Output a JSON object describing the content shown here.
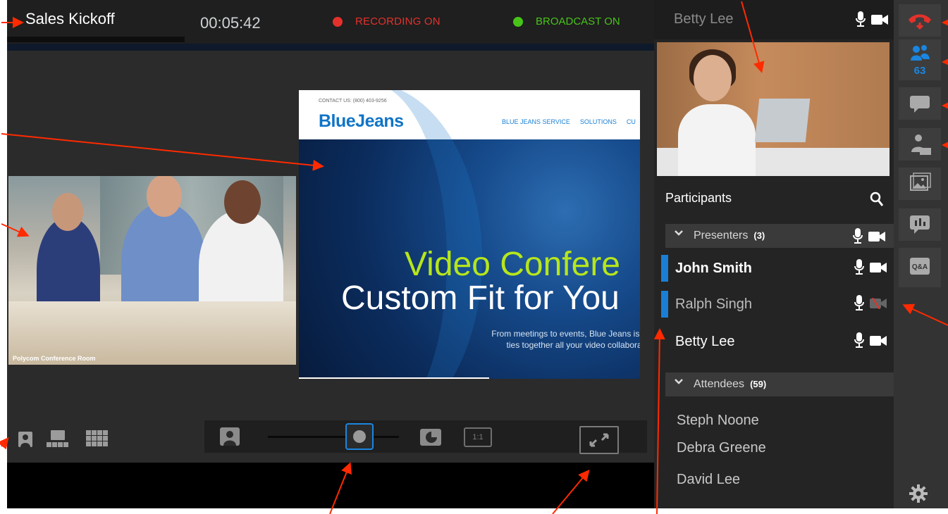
{
  "meeting": {
    "title": "Sales Kickoff",
    "timer": "00:05:42",
    "recording_label": "RECORDING ON",
    "broadcast_label": "BROADCAST ON",
    "recording_color": "#e4312b",
    "broadcast_color": "#48c418"
  },
  "stage": {
    "room_label": "Polycom Conference Room",
    "share": {
      "contact": "CONTACT US: (800) 403-9256",
      "logo": "BlueJeans",
      "nav": [
        "BLUE JEANS SERVICE",
        "SOLUTIONS",
        "CU"
      ],
      "hero_line1": "Video Confere",
      "hero_line2": "Custom Fit for You",
      "tagline_line1": "From meetings to events, Blue Jeans is t",
      "tagline_line2": "ties together all your video collaborat"
    }
  },
  "toolbar": {
    "ratio_label": "1:1"
  },
  "right_panel": {
    "speaker_name": "Betty Lee",
    "participants_title": "Participants",
    "presenters": {
      "label": "Presenters",
      "count": "(3)",
      "people": [
        "John Smith",
        "Ralph Singh",
        "Betty Lee"
      ]
    },
    "attendees": {
      "label": "Attendees",
      "count": "(59)",
      "people": [
        "Steph Noone",
        "Debra Greene",
        "David Lee"
      ]
    }
  },
  "rail": {
    "people_count": "63",
    "qa_label": "Q&A"
  },
  "colors": {
    "accent": "#1a86e0",
    "annotation_arrow": "#ff2a00"
  }
}
